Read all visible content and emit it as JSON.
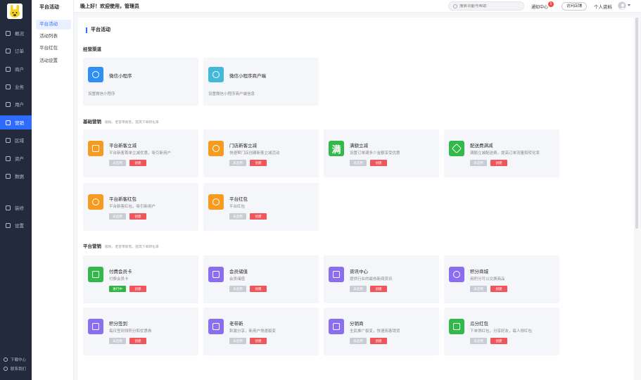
{
  "nav": {
    "items": [
      {
        "label": "概况",
        "icon": "dashboard-icon"
      },
      {
        "label": "订单",
        "icon": "order-icon"
      },
      {
        "label": "商户",
        "icon": "merchant-icon"
      },
      {
        "label": "业务",
        "icon": "business-icon"
      },
      {
        "label": "用户",
        "icon": "user-icon"
      },
      {
        "label": "营销",
        "icon": "marketing-icon"
      },
      {
        "label": "区域",
        "icon": "region-icon"
      },
      {
        "label": "资产",
        "icon": "asset-icon"
      },
      {
        "label": "数据",
        "icon": "data-icon"
      },
      {
        "label": "装修",
        "icon": "decorate-icon"
      },
      {
        "label": "设置",
        "icon": "settings-icon"
      }
    ],
    "active": "营销",
    "footer": [
      {
        "label": "下载中心",
        "icon": "download-icon"
      },
      {
        "label": "联系我们",
        "icon": "headset-icon"
      }
    ]
  },
  "subnav": {
    "title": "平台活动",
    "items": [
      "平台活动",
      "活动列表",
      "平台红包",
      "活动设置"
    ],
    "active": "平台活动"
  },
  "header": {
    "greeting": "晚上好！欢迎使用，管理员",
    "search_placeholder": "搜索功能与帮助",
    "notify_label": "通知中心",
    "notify_count": "5",
    "visit_label": "访问店铺",
    "profile_label": "个人资料"
  },
  "page": {
    "title": "平台活动",
    "sections": [
      {
        "title": "经营渠道",
        "subtitle": "",
        "cards": [
          {
            "name": "微信小程序",
            "desc": "设置微信小程序",
            "icon": "mini-program-icon",
            "color": "#2f8ff5"
          },
          {
            "name": "微信小程序商户端",
            "desc": "设置微信小程序商户端信息",
            "icon": "mini-program-merchant-icon",
            "color": "#44b8d8"
          }
        ]
      },
      {
        "title": "基础营销",
        "subtitle": "吸粉、老客带新客，提高下单转化率",
        "cards": [
          {
            "name": "平台新客立减",
            "desc": "平台新客首单立减优惠，吸引新用户",
            "icon": "new-customer-icon",
            "color": "#f59b20",
            "tags": [
              "未启用",
              "创建"
            ]
          },
          {
            "name": "门店新客立减",
            "desc": "快速帮门店创建新客立减活动",
            "icon": "store-discount-icon",
            "color": "#f59b20",
            "tags": [
              "未启用",
              "创建"
            ]
          },
          {
            "name": "满额立减",
            "desc": "设置订单满多少金额享受优惠",
            "icon": "full-reduce-icon",
            "color": "#33b84a",
            "glyph": "满",
            "tags": [
              "未启用",
              "创建"
            ]
          },
          {
            "name": "配送费满减",
            "desc": "满额立减配送费，提高订单流量和转化率",
            "icon": "delivery-fee-icon",
            "color": "#33b84a",
            "tags": [
              "未启用",
              "创建"
            ]
          },
          {
            "name": "平台新客红包",
            "desc": "平台新客红包，吸引新用户",
            "icon": "red-packet-icon",
            "color": "#f59b20",
            "tags": [
              "未启用",
              "创建"
            ]
          },
          {
            "name": "平台红包",
            "desc": "平台红包",
            "icon": "platform-packet-icon",
            "color": "#f59b20",
            "tags": [
              "未启用",
              "创建"
            ]
          }
        ]
      },
      {
        "title": "平台营销",
        "subtitle": "吸粉、老客带新客，提高下单转化率",
        "cards": [
          {
            "name": "付费会员卡",
            "desc": "付费会员卡",
            "icon": "member-card-icon",
            "color": "#33b84a",
            "tags": [
              "进行中",
              "创建"
            ]
          },
          {
            "name": "会员储值",
            "desc": "会员储值",
            "icon": "stored-value-icon",
            "color": "#8b6ef0",
            "tags": [
              "未启用",
              "创建"
            ]
          },
          {
            "name": "资讯中心",
            "desc": "提供行业的最热新闻资讯",
            "icon": "news-icon",
            "color": "#8b6ef0",
            "tags": [
              "未启用",
              "创建"
            ]
          },
          {
            "name": "积分商城",
            "desc": "用积分可以兑换商品",
            "icon": "points-mall-icon",
            "color": "#8b6ef0",
            "tags": [
              "未启用",
              "创建"
            ]
          },
          {
            "name": "积分签到",
            "desc": "每日签到领积分和优惠券",
            "icon": "checkin-icon",
            "color": "#8b6ef0",
            "tags": [
              "未启用",
              "创建"
            ]
          },
          {
            "name": "老带新",
            "desc": "刺激分享，新用户快速裂变",
            "icon": "invite-icon",
            "color": "#8b6ef0",
            "tags": [
              "未启用",
              "创建"
            ]
          },
          {
            "name": "分销商",
            "desc": "全民推广裂变，快速拓客销货",
            "icon": "distributor-icon",
            "color": "#8b6ef0",
            "tags": [
              "未启用",
              "创建"
            ]
          },
          {
            "name": "瓜分红包",
            "desc": "下单得红包，分享好友，每人得红包",
            "icon": "split-packet-icon",
            "color": "#33b84a",
            "tags": [
              "未启用",
              "创建"
            ]
          }
        ]
      }
    ]
  }
}
